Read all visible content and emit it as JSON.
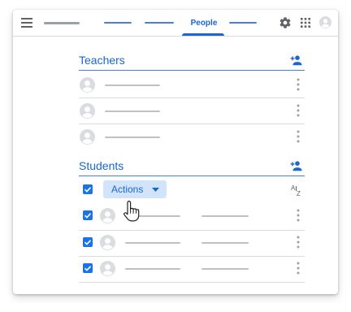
{
  "topbar": {
    "active_tab": "People",
    "icons": [
      "menu-icon",
      "gear-icon",
      "apps-icon",
      "account-icon"
    ]
  },
  "teachers": {
    "title": "Teachers",
    "rows": 3
  },
  "students": {
    "title": "Students",
    "select_all_checked": true,
    "actions_label": "Actions",
    "sort_icon": "sort-az-icon",
    "rows": 3,
    "rows_checked": [
      true,
      true,
      true
    ]
  },
  "colors": {
    "accent": "#1967d2",
    "checkbox": "#1a73e8",
    "actions_bg": "#d2e3fc",
    "placeholder": "#bdc1c6",
    "icon_grey": "#5f6368"
  }
}
